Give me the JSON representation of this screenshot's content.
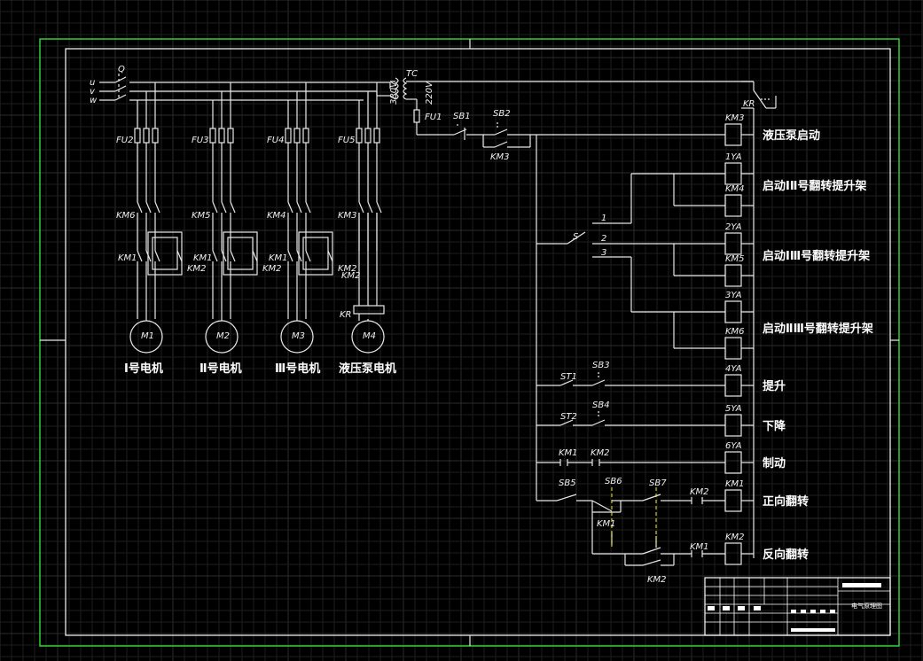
{
  "colors": {
    "background": "#000000",
    "border": "#33cc33",
    "wire": "#e8e8e8",
    "dash": "#e8e820"
  },
  "power": {
    "phases": [
      "u",
      "v",
      "w"
    ],
    "switch": "Q",
    "transformer": "TC",
    "primary": "380V",
    "secondary": "220V",
    "fuse": "FU1"
  },
  "fuses": [
    "FU2",
    "FU3",
    "FU4",
    "FU5"
  ],
  "contactors_main": [
    "KM6",
    "KM5",
    "KM4",
    "KM3"
  ],
  "reversing": {
    "fwd": "KM1",
    "rev": "KM2"
  },
  "relay": "KR",
  "motors": [
    {
      "id": "M1",
      "label": "Ⅰ号电机"
    },
    {
      "id": "M2",
      "label": "Ⅱ号电机"
    },
    {
      "id": "M3",
      "label": "Ⅲ号电机"
    },
    {
      "id": "M4",
      "label": "液压泵电机"
    }
  ],
  "control": {
    "sb1": "SB1",
    "sb2": "SB2",
    "km3": "KM3",
    "kr": "KR",
    "selector": "S",
    "pos": [
      "1",
      "2",
      "3"
    ],
    "st1": "ST1",
    "sb3": "SB3",
    "st2": "ST2",
    "sb4": "SB4",
    "km1": "KM1",
    "km2": "KM2",
    "sb5": "SB5",
    "sb6": "SB6",
    "sb7": "SB7"
  },
  "coils": [
    {
      "id": "KM3",
      "desc": "液压泵启动"
    },
    {
      "id": "1YA",
      "desc": ""
    },
    {
      "id": "KM4",
      "desc": "启动ⅠⅡ号翻转提升架"
    },
    {
      "id": "2YA",
      "desc": ""
    },
    {
      "id": "KM5",
      "desc": "启动ⅠⅢ号翻转提升架"
    },
    {
      "id": "3YA",
      "desc": ""
    },
    {
      "id": "KM6",
      "desc": "启动ⅡⅢ号翻转提升架"
    },
    {
      "id": "4YA",
      "desc": "提升"
    },
    {
      "id": "5YA",
      "desc": "下降"
    },
    {
      "id": "6YA",
      "desc": "制动"
    },
    {
      "id": "KM1",
      "desc": "正向翻转"
    },
    {
      "id": "KM2",
      "desc": "反向翻转"
    }
  ],
  "title_block": {
    "name": "电气原理图"
  }
}
